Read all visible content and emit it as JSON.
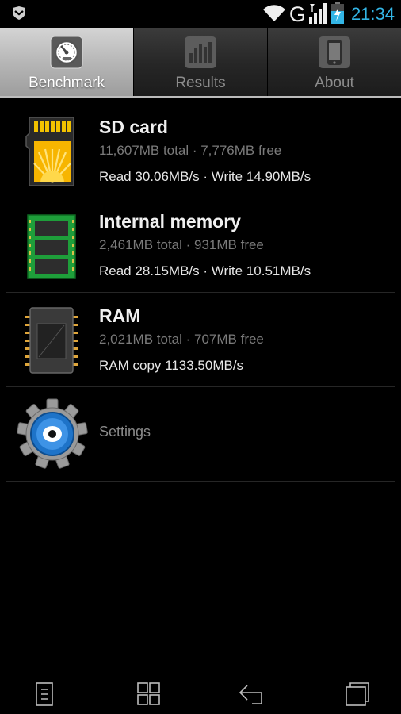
{
  "status_bar": {
    "network": "G",
    "time": "21:34",
    "icons": [
      "notification-shield-icon",
      "wifi-icon",
      "signal-icon",
      "battery-charging-icon"
    ]
  },
  "tabs": [
    {
      "label": "Benchmark",
      "icon": "speedometer-icon",
      "active": true
    },
    {
      "label": "Results",
      "icon": "bar-chart-icon",
      "active": false
    },
    {
      "label": "About",
      "icon": "phone-icon",
      "active": false
    }
  ],
  "items": [
    {
      "title": "SD card",
      "details": "11,607MB total · 7,776MB free",
      "speed": "Read 30.06MB/s · Write 14.90MB/s",
      "icon": "sd-card-icon"
    },
    {
      "title": "Internal memory",
      "details": "2,461MB total · 931MB free",
      "speed": "Read 28.15MB/s · Write 10.51MB/s",
      "icon": "memory-board-icon"
    },
    {
      "title": "RAM",
      "details": "2,021MB total · 707MB free",
      "speed": "RAM copy 1133.50MB/s",
      "icon": "ram-chip-icon"
    }
  ],
  "settings": {
    "label": "Settings",
    "icon": "gear-icon"
  },
  "nav_bar": [
    "menu-icon",
    "home-icon",
    "back-icon",
    "recent-apps-icon"
  ],
  "colors": {
    "accent": "#33b5e5",
    "background": "#000000",
    "tab_active": "#b4b4b4"
  }
}
